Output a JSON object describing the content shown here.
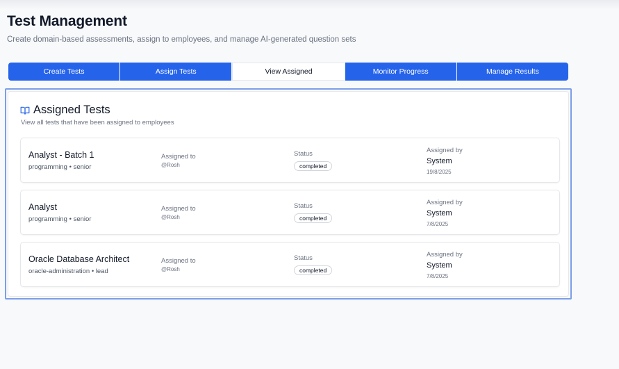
{
  "header": {
    "title": "Test Management",
    "subtitle": "Create domain-based assessments, assign to employees, and manage AI-generated question sets"
  },
  "tabs": [
    {
      "label": "Create Tests"
    },
    {
      "label": "Assign Tests"
    },
    {
      "label": "View Assigned"
    },
    {
      "label": "Monitor Progress"
    },
    {
      "label": "Manage Results"
    }
  ],
  "active_tab": "View Assigned",
  "card": {
    "icon": "book-open-icon",
    "title": "Assigned Tests",
    "description": "View all tests that have been assigned to employees"
  },
  "columns": {
    "assigned_to": "Assigned to",
    "status": "Status",
    "assigned_by": "Assigned by"
  },
  "assignments": [
    {
      "name": "Analyst - Batch 1",
      "meta": "programming • senior",
      "assignee": "@Rosh",
      "status": "completed",
      "assigner": "System",
      "date": "19/8/2025"
    },
    {
      "name": "Analyst",
      "meta": "programming • senior",
      "assignee": "@Rosh",
      "status": "completed",
      "assigner": "System",
      "date": "7/8/2025"
    },
    {
      "name": "Oracle Database Architect",
      "meta": "oracle-administration • lead",
      "assignee": "@Rosh",
      "status": "completed",
      "assigner": "System",
      "date": "7/8/2025"
    }
  ],
  "colors": {
    "accent": "#2563eb",
    "focus_outline": "#7c9ee8"
  }
}
